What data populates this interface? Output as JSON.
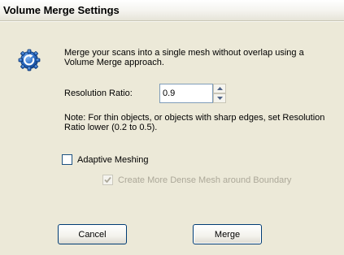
{
  "window": {
    "title": "Volume Merge Settings"
  },
  "description": "Merge your scans into a single mesh without overlap using a Volume Merge approach.",
  "resolution": {
    "label": "Resolution Ratio:",
    "value": "0.9"
  },
  "note": "Note:  For thin objects, or objects with sharp edges, set Resolution Ratio lower (0.2 to 0.5).",
  "options": {
    "adaptive_meshing": {
      "label": "Adaptive Meshing",
      "checked": false
    },
    "dense_mesh": {
      "label": "Create More Dense Mesh around Boundary",
      "checked": true,
      "enabled": false
    }
  },
  "buttons": {
    "cancel": "Cancel",
    "merge": "Merge"
  },
  "icons": {
    "app": "refresh-gear-icon",
    "spin_up": "arrow-up-icon",
    "spin_down": "arrow-down-icon",
    "check": "checkmark-icon"
  },
  "colors": {
    "background": "#ece9d8",
    "icon_blue": "#1f5fb8",
    "disabled_text": "#aca899"
  }
}
